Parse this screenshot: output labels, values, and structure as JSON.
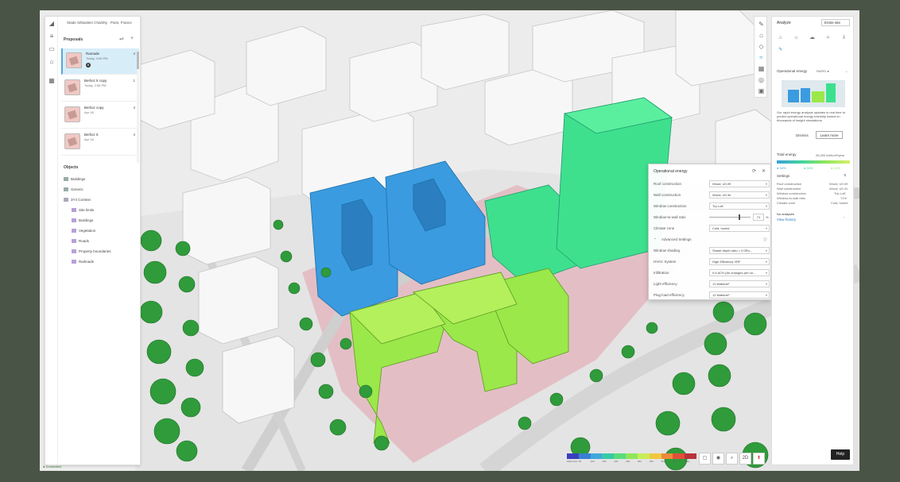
{
  "project": {
    "title": "Stade Sébastien Charléty · Paris, France"
  },
  "rail_icons": [
    "logo-icon",
    "menu-icon",
    "layers-icon",
    "map-icon",
    "grid-icon"
  ],
  "proposals": {
    "heading": "Proposals",
    "items": [
      {
        "name": "Ramade",
        "date": "Today, 4:06 PM",
        "count": "4",
        "badge": "B",
        "selected": true
      },
      {
        "name": "Berlioz 5 copy",
        "date": "Today, 2:55 PM",
        "count": "1",
        "badge": "",
        "selected": false
      },
      {
        "name": "Berlioz copy",
        "date": "Apr 18",
        "count": "4",
        "badge": "",
        "selected": false
      },
      {
        "name": "Berlioz 5",
        "date": "Apr 18",
        "count": "4",
        "badge": "",
        "selected": false
      }
    ]
  },
  "objects": {
    "heading": "Objects",
    "items": [
      {
        "label": "Buildings",
        "indent": 0,
        "color": "#9aa"
      },
      {
        "label": "Generic",
        "indent": 0,
        "color": "#9aa"
      },
      {
        "label": "3Y4 Context",
        "indent": 0,
        "color": "#aab"
      },
      {
        "label": "Site limits",
        "indent": 1,
        "color": "#b8a0d6"
      },
      {
        "label": "Buildings",
        "indent": 1,
        "color": "#b8a0d6"
      },
      {
        "label": "Vegetation",
        "indent": 1,
        "color": "#b8a0d6"
      },
      {
        "label": "Roads",
        "indent": 1,
        "color": "#b8a0d6"
      },
      {
        "label": "Property boundaries",
        "indent": 1,
        "color": "#b8a0d6"
      },
      {
        "label": "Railroads",
        "indent": 1,
        "color": "#b8a0d6"
      }
    ]
  },
  "tools": [
    "pencil-icon",
    "building-icon",
    "shape-icon",
    "wind-icon",
    "grid-tool-icon",
    "target-icon",
    "cube-icon"
  ],
  "analyze": {
    "title": "Analyze",
    "scope": "Entire site",
    "categories": [
      "building-cat-icon",
      "sun-icon",
      "cloud-icon",
      "wind-cat-icon",
      "thermometer-icon",
      "energy-icon"
    ],
    "section": "Operational energy",
    "section_badge": "RAPID ●",
    "description": "Our rapid energy analysis updates in real time to predict operational energy intensity based on thousands of insight simulations.",
    "dismiss": "Dismiss",
    "learn_more": "Learn more",
    "total_label": "Total energy",
    "total_value": "26,300 kWh/m²/year",
    "bar_labels": [
      "● 54%",
      "● 34%",
      "● 12%"
    ],
    "settings_label": "Settings",
    "settings": [
      {
        "k": "Roof construction",
        "v": "Wood; U0.09"
      },
      {
        "k": "Wall construction",
        "v": "Wood; U0.31"
      },
      {
        "k": "Window construction",
        "v": "Trip LoE"
      },
      {
        "k": "Window-to-wall ratio",
        "v": "71%"
      },
      {
        "k": "Climate zone",
        "v": "Cold; humid"
      }
    ],
    "no_analyses": "No analyses",
    "view_history": "View history"
  },
  "op_dialog": {
    "title": "Operational energy",
    "rows": [
      {
        "label": "Roof construction",
        "value": "Wood; U0.09"
      },
      {
        "label": "Wall construction",
        "value": "Wood; U0.3e"
      },
      {
        "label": "Window construction",
        "value": "Trp LoE"
      },
      {
        "label": "Window-to-wall ratio",
        "value": "71",
        "slider": 0.71
      },
      {
        "label": "Climate zone",
        "value": "Cold; humid"
      }
    ],
    "advanced": "Advanced Settings",
    "adv_rows": [
      {
        "label": "Window shading",
        "value": "Shade depth ratio = 0.0Ro..."
      },
      {
        "label": "HVAC System",
        "value": "High Efficiency VRF"
      },
      {
        "label": "Infiltration",
        "value": "0.6 ACH (Air changes per ho..."
      },
      {
        "label": "Light efficiency",
        "value": "12 Watts/m²"
      },
      {
        "label": "Plug load efficiency",
        "value": "12 Watts/m²"
      }
    ]
  },
  "legend": {
    "colors": [
      "#3c3fbf",
      "#3a7fd6",
      "#3fa8dc",
      "#38c9a6",
      "#56dd7a",
      "#8fe65a",
      "#c8ec58",
      "#f0c83e",
      "#ee8a3a",
      "#e14f3a",
      "#b8323a"
    ],
    "labels": [
      "kWh/m²/yr",
      "50",
      "100",
      "150",
      "200",
      "250",
      "300",
      "350",
      "400",
      "450",
      "500+"
    ]
  },
  "view_controls": [
    "square-view-icon",
    "eye-icon",
    "search-icon",
    "2D",
    "compass-icon"
  ],
  "help": "Help",
  "status": "● Connected"
}
